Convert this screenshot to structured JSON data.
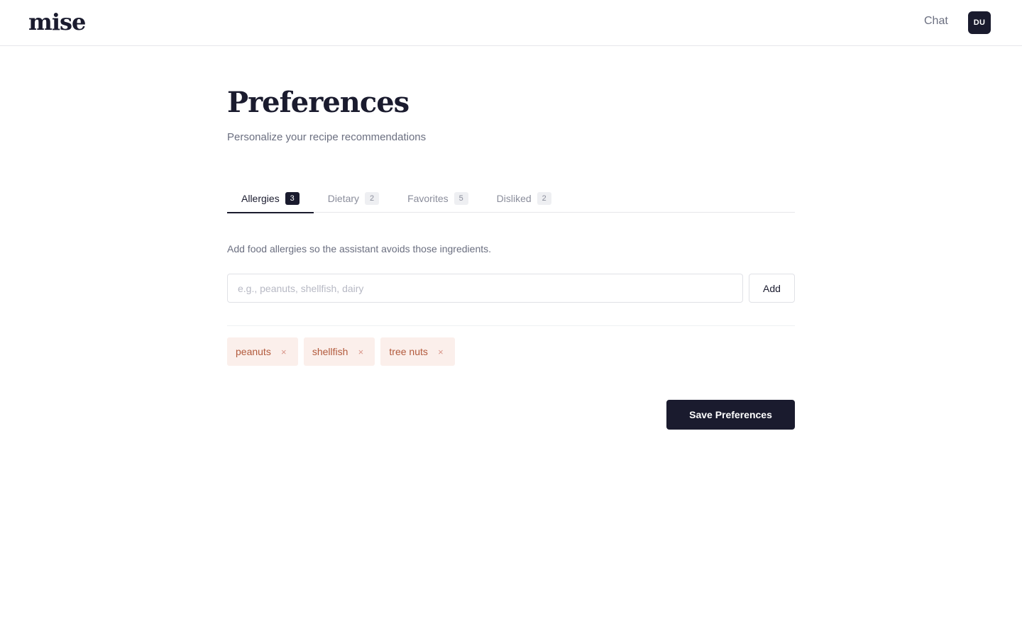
{
  "header": {
    "logo": "mise",
    "nav_chat": "Chat",
    "avatar_initials": "DU"
  },
  "page": {
    "title": "Preferences",
    "subtitle": "Personalize your recipe recommendations"
  },
  "tabs": [
    {
      "label": "Allergies",
      "count": "3",
      "active": true
    },
    {
      "label": "Dietary",
      "count": "2",
      "active": false
    },
    {
      "label": "Favorites",
      "count": "5",
      "active": false
    },
    {
      "label": "Disliked",
      "count": "2",
      "active": false
    }
  ],
  "allergies": {
    "description": "Add food allergies so the assistant avoids those ingredients.",
    "input_placeholder": "e.g., peanuts, shellfish, dairy",
    "input_value": "",
    "add_label": "Add",
    "items": [
      "peanuts",
      "shellfish",
      "tree nuts"
    ],
    "remove_glyph": "×"
  },
  "actions": {
    "save_label": "Save Preferences"
  },
  "colors": {
    "primary": "#1a1b2e",
    "chip_bg": "#fbefeb",
    "chip_text": "#b25a3c",
    "muted_text": "#6b6f80"
  }
}
